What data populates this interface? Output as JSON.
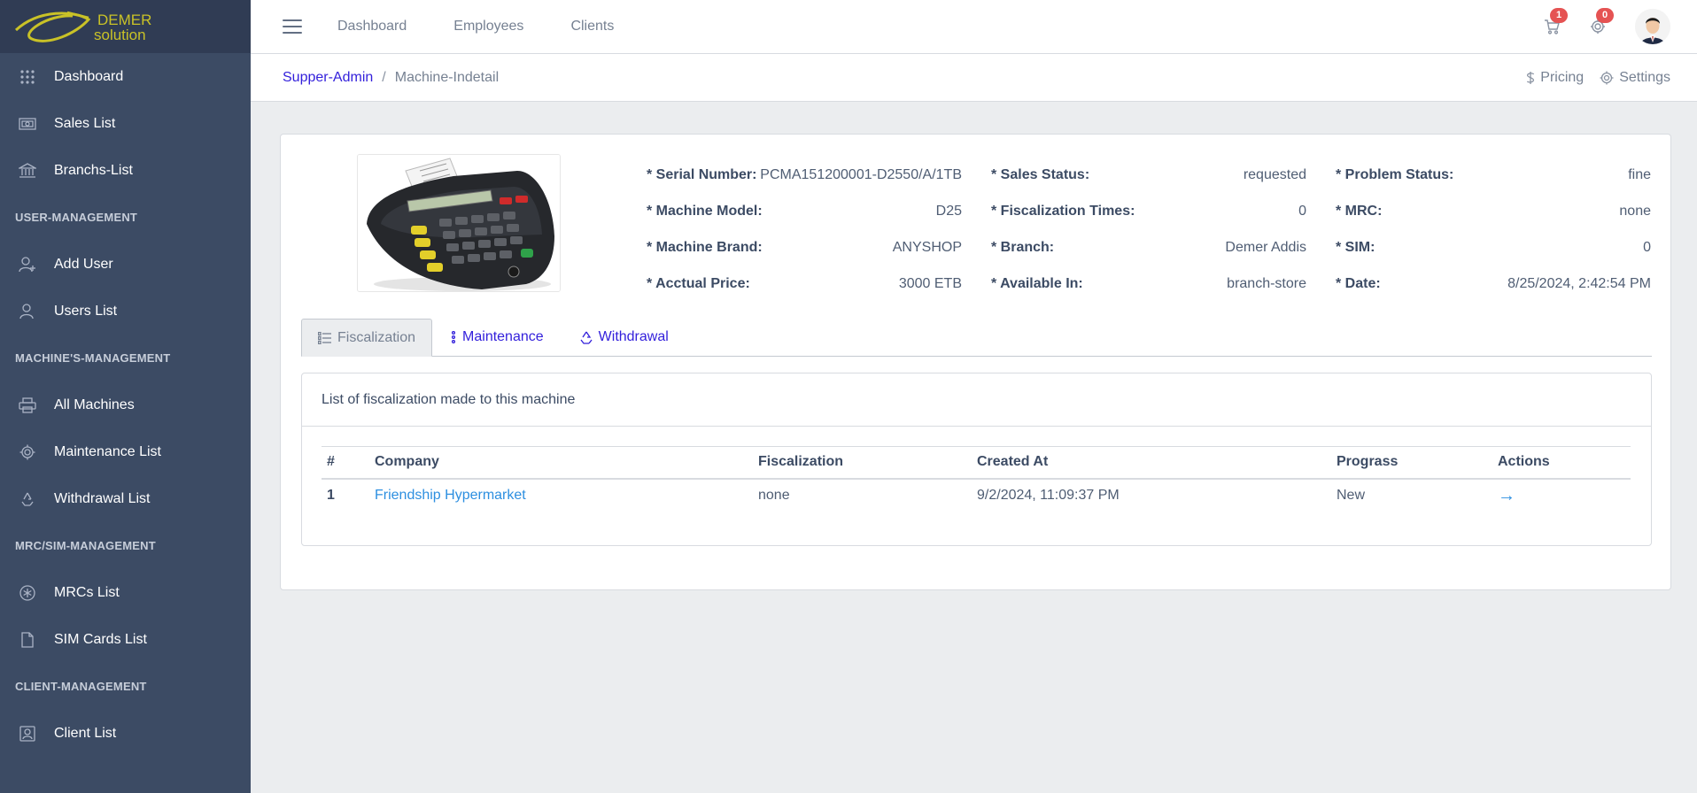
{
  "brand": {
    "line1": "DEMER",
    "line2": "solution"
  },
  "sidebar": {
    "items": [
      {
        "label": "Dashboard",
        "icon": "grid-icon"
      },
      {
        "label": "Sales List",
        "icon": "money-icon"
      },
      {
        "label": "Branchs-List",
        "icon": "bank-icon"
      }
    ],
    "section_user": "USER-MANAGEMENT",
    "user_items": [
      {
        "label": "Add User",
        "icon": "user-plus-icon"
      },
      {
        "label": "Users List",
        "icon": "users-icon"
      }
    ],
    "section_machine": "MACHINE'S-MANAGEMENT",
    "machine_items": [
      {
        "label": "All Machines",
        "icon": "printer-icon"
      },
      {
        "label": "Maintenance List",
        "icon": "gear-icon"
      },
      {
        "label": "Withdrawal List",
        "icon": "recycle-icon"
      }
    ],
    "section_mrc": "MRC/SIM-MANAGEMENT",
    "mrc_items": [
      {
        "label": "MRCs List",
        "icon": "asterisk-icon"
      },
      {
        "label": "SIM Cards List",
        "icon": "file-icon"
      }
    ],
    "section_client": "CLIENT-MANAGEMENT",
    "client_items": [
      {
        "label": "Client List",
        "icon": "contact-icon"
      }
    ]
  },
  "header": {
    "nav": [
      "Dashboard",
      "Employees",
      "Clients"
    ],
    "cart_count": "1",
    "settings_count": "0"
  },
  "breadcrumb": {
    "root": "Supper-Admin",
    "sep": "/",
    "current": "Machine-Indetail"
  },
  "subheader": {
    "pricing": "Pricing",
    "settings": "Settings"
  },
  "machine": {
    "col1": [
      {
        "label": "* Serial Number:",
        "value": "PCMA151200001-D2550/A/1TB"
      },
      {
        "label": "* Machine Model:",
        "value": "D25"
      },
      {
        "label": "* Machine Brand:",
        "value": "ANYSHOP"
      },
      {
        "label": "* Acctual Price:",
        "value": "3000 ETB"
      }
    ],
    "col2": [
      {
        "label": "* Sales Status:",
        "value": "requested"
      },
      {
        "label": "* Fiscalization Times:",
        "value": "0"
      },
      {
        "label": "* Branch:",
        "value": "Demer Addis"
      },
      {
        "label": "* Available In:",
        "value": "branch-store"
      }
    ],
    "col3": [
      {
        "label": "* Problem Status:",
        "value": "fine"
      },
      {
        "label": "* MRC:",
        "value": "none"
      },
      {
        "label": "* SIM:",
        "value": "0"
      },
      {
        "label": "* Date:",
        "value": "8/25/2024, 2:42:54 PM"
      }
    ]
  },
  "tabs": [
    "Fiscalization",
    "Maintenance",
    "Withdrawal"
  ],
  "panel": {
    "title": "List of fiscalization made to this machine",
    "columns": [
      "#",
      "Company",
      "Fiscalization",
      "Created At",
      "Prograss",
      "Actions"
    ],
    "rows": [
      {
        "num": "1",
        "company": "Friendship Hypermarket",
        "fiscalization": "none",
        "created_at": "9/2/2024, 11:09:37 PM",
        "progress": "New",
        "action": "→"
      }
    ]
  },
  "colors": {
    "sidebar": "#3c4b64",
    "link": "#321fdb",
    "badge": "#e55353",
    "company_link": "#2d8fe0"
  }
}
